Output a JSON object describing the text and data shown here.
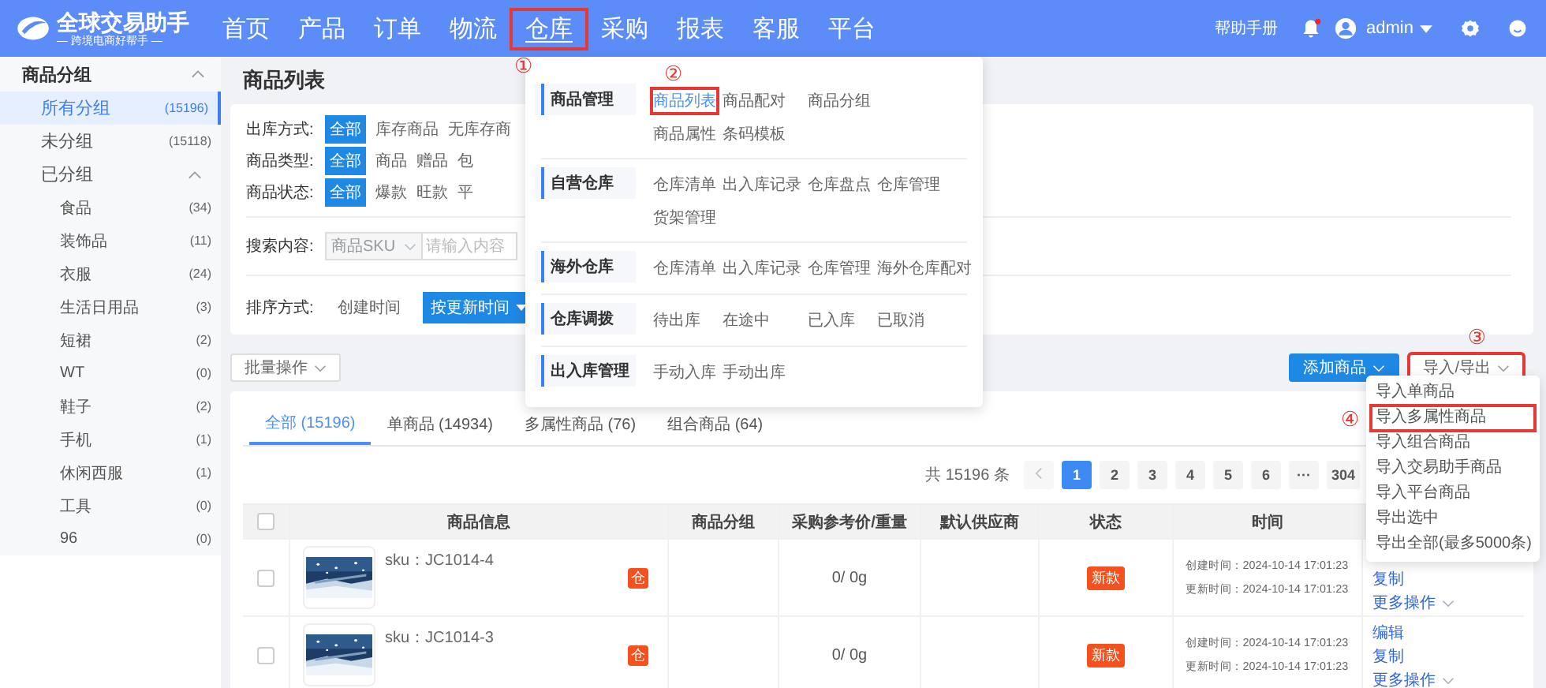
{
  "header": {
    "logo": {
      "title": "全球交易助手",
      "subtitle": "— 跨境电商好帮手 —"
    },
    "nav": [
      {
        "label": "首页",
        "selected": false
      },
      {
        "label": "产品",
        "selected": false
      },
      {
        "label": "订单",
        "selected": false
      },
      {
        "label": "物流",
        "selected": false
      },
      {
        "label": "仓库",
        "selected": true,
        "marker": "①"
      },
      {
        "label": "采购",
        "selected": false
      },
      {
        "label": "报表",
        "selected": false
      },
      {
        "label": "客服",
        "selected": false
      },
      {
        "label": "平台",
        "selected": false
      }
    ],
    "help": "帮助手册",
    "user": "admin"
  },
  "sidebar": {
    "title": "商品分组",
    "expanded": true,
    "items": [
      {
        "label": "所有分组",
        "count": "(15196)",
        "selected": true
      },
      {
        "label": "未分组",
        "count": "(15118)",
        "selected": false
      },
      {
        "label": "已分组",
        "selected": false,
        "expanded": true,
        "children": [
          {
            "label": "食品",
            "count": "(34)",
            "selected": false
          },
          {
            "label": "装饰品",
            "count": "(11)",
            "selected": false
          },
          {
            "label": "衣服",
            "count": "(24)",
            "selected": false
          },
          {
            "label": "生活日用品",
            "count": "(3)",
            "selected": false
          },
          {
            "label": "短裙",
            "count": "(2)",
            "selected": false
          },
          {
            "label": "WT",
            "count": "(0)",
            "selected": false
          },
          {
            "label": "鞋子",
            "count": "(2)",
            "selected": false
          },
          {
            "label": "手机",
            "count": "(1)",
            "selected": false
          },
          {
            "label": "休闲西服",
            "count": "(1)",
            "selected": false
          },
          {
            "label": "工具",
            "count": "(0)",
            "selected": false
          },
          {
            "label": "96",
            "count": "(0)",
            "selected": false
          }
        ]
      }
    ]
  },
  "page_title": "商品列表",
  "filters": [
    {
      "label": "出库方式:",
      "options": [
        {
          "label": "全部",
          "selected": true
        },
        {
          "label": "库存商品",
          "selected": false
        },
        {
          "label": "无库存商",
          "selected": false
        }
      ]
    },
    {
      "label": "商品类型:",
      "options": [
        {
          "label": "全部",
          "selected": true
        },
        {
          "label": "商品",
          "selected": false
        },
        {
          "label": "赠品",
          "selected": false
        },
        {
          "label": "包",
          "selected": false
        }
      ]
    },
    {
      "label": "商品状态:",
      "options": [
        {
          "label": "全部",
          "selected": true
        },
        {
          "label": "爆款",
          "selected": false
        },
        {
          "label": "旺款",
          "selected": false
        },
        {
          "label": "平",
          "selected": false
        }
      ]
    }
  ],
  "search": {
    "label": "搜索内容:",
    "field": "商品SKU",
    "placeholder": "请输入内容"
  },
  "sort": {
    "label": "排序方式:",
    "options": [
      {
        "label": "创建时间",
        "selected": false
      },
      {
        "label": "按更新时间",
        "selected": true
      }
    ]
  },
  "batch_button": "批量操作",
  "add_button": "添加商品",
  "import_export_button": {
    "label": "导入/导出",
    "marker": "③"
  },
  "tabs": [
    {
      "label": "全部 (15196)",
      "selected": true
    },
    {
      "label": "单商品 (14934)",
      "selected": false
    },
    {
      "label": "多属性商品 (76)",
      "selected": false
    },
    {
      "label": "组合商品 (64)",
      "selected": false
    }
  ],
  "pagination": {
    "total": "共 15196 条",
    "pages": [
      {
        "label": "1",
        "selected": true
      },
      {
        "label": "2",
        "selected": false
      },
      {
        "label": "3",
        "selected": false
      },
      {
        "label": "4",
        "selected": false
      },
      {
        "label": "5",
        "selected": false
      },
      {
        "label": "6",
        "selected": false
      },
      {
        "label": "···",
        "selected": false
      },
      {
        "label": "304",
        "selected": false
      }
    ]
  },
  "table": {
    "select_all_checked": false,
    "columns": [
      "商品信息",
      "商品分组",
      "采购参考价/重量",
      "默认供应商",
      "状态",
      "时间"
    ],
    "rows": [
      {
        "checked": false,
        "sku": "sku：JC1014-4",
        "badge": "仓",
        "price_weight": "0/ 0g",
        "status": "新款",
        "created": "创建时间：2024-10-14 17:01:23",
        "updated": "更新时间：2024-10-14 17:01:23",
        "actions": [
          "复制",
          "更多操作"
        ]
      },
      {
        "checked": false,
        "sku": "sku：JC1014-3",
        "badge": "仓",
        "price_weight": "0/ 0g",
        "status": "新款",
        "created": "创建时间：2024-10-14 17:01:23",
        "updated": "更新时间：2024-10-14 17:01:23",
        "actions": [
          "编辑",
          "复制",
          "更多操作"
        ]
      }
    ]
  },
  "warehouse_menu": {
    "groups": [
      {
        "title": "商品管理",
        "rows": [
          [
            {
              "label": "商品列表",
              "selected": true,
              "marker": "②"
            },
            {
              "label": "商品配对",
              "selected": false
            },
            {
              "label": "商品分组",
              "selected": false
            }
          ],
          [
            {
              "label": "商品属性",
              "selected": false
            },
            {
              "label": "条码模板",
              "selected": false
            }
          ]
        ]
      },
      {
        "title": "自营仓库",
        "rows": [
          [
            {
              "label": "仓库清单",
              "selected": false
            },
            {
              "label": "出入库记录",
              "selected": false
            },
            {
              "label": "仓库盘点",
              "selected": false
            },
            {
              "label": "仓库管理",
              "selected": false
            }
          ],
          [
            {
              "label": "货架管理",
              "selected": false
            }
          ]
        ]
      },
      {
        "title": "海外仓库",
        "rows": [
          [
            {
              "label": "仓库清单",
              "selected": false
            },
            {
              "label": "出入库记录",
              "selected": false
            },
            {
              "label": "仓库管理",
              "selected": false
            },
            {
              "label": "海外仓库配对",
              "selected": false
            }
          ]
        ]
      },
      {
        "title": "仓库调拨",
        "rows": [
          [
            {
              "label": "待出库",
              "selected": false
            },
            {
              "label": "在途中",
              "selected": false
            },
            {
              "label": "已入库",
              "selected": false
            },
            {
              "label": "已取消",
              "selected": false
            }
          ]
        ]
      },
      {
        "title": "出入库管理",
        "rows": [
          [
            {
              "label": "手动入库",
              "selected": false
            },
            {
              "label": "手动出库",
              "selected": false
            }
          ]
        ]
      }
    ]
  },
  "import_menu": {
    "items": [
      {
        "label": "导入单商品"
      },
      {
        "label": "导入多属性商品",
        "marker": "④"
      },
      {
        "label": "导入组合商品"
      },
      {
        "label": "导入交易助手商品"
      },
      {
        "label": "导入平台商品"
      },
      {
        "label": "导出选中"
      },
      {
        "label": "导出全部(最多5000条)"
      }
    ]
  }
}
